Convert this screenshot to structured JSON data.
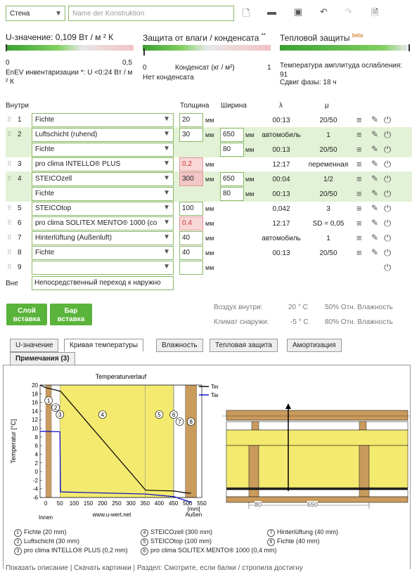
{
  "top": {
    "construction_type": "Стена",
    "name_placeholder": "Name der Konstruktion"
  },
  "ratings": {
    "u_title": "U-значение: 0,109 Вт / м ² К",
    "u_scale_min": "0",
    "u_scale_max": "0,5",
    "u_note": "EnEV инвентаризации *: U <0:24 Вт / м ² К",
    "moist_title": "Защита от влаги / конденсата",
    "moist_stars": "**",
    "moist_min": "0",
    "moist_label": "Конденсат (кг / м²)",
    "moist_max": "1",
    "moist_note": "Нет конденсата",
    "heat_title": "Тепловой защиты",
    "heat_beta": "beta",
    "heat_note1": "Температура амплитуда ослабления: 91",
    "heat_note2": "Сдвиг фазы: 18 ч"
  },
  "table": {
    "col_inside": "Внутри",
    "col_thickness": "Толщина",
    "col_width": "Ширина",
    "col_lambda": "λ",
    "col_mu": "μ",
    "rows": [
      {
        "num": "1",
        "mat": "Fichte",
        "thick": "20",
        "unit": "мм",
        "width": "",
        "lambda": "00:13",
        "mu": "20/50"
      },
      {
        "num": "2",
        "mat": "Luftschicht (ruhend)",
        "thick": "30",
        "unit": "мм",
        "width": "650",
        "wunit": "мм",
        "lambda": "автомобиль",
        "mu": "1"
      },
      {
        "num": "",
        "mat": "Fichte",
        "thick": "",
        "unit": "",
        "width": "80",
        "wunit": "мм",
        "lambda": "00:13",
        "mu": "20/50"
      },
      {
        "num": "3",
        "mat": "pro clima INTELLO® PLUS",
        "thick": "0.2",
        "unit": "мм",
        "width": "",
        "lambda": "12:17",
        "mu": "переменная"
      },
      {
        "num": "4",
        "mat": "STEICOzell",
        "thick": "300",
        "unit": "мм",
        "width": "650",
        "wunit": "мм",
        "lambda": "00:04",
        "mu": "1/2"
      },
      {
        "num": "",
        "mat": "Fichte",
        "thick": "",
        "unit": "",
        "width": "80",
        "wunit": "мм",
        "lambda": "00:13",
        "mu": "20/50"
      },
      {
        "num": "5",
        "mat": "STEICOtop",
        "thick": "100",
        "unit": "мм",
        "width": "",
        "lambda": "0,042",
        "mu": "3"
      },
      {
        "num": "6",
        "mat": "pro clima SOLITEX MENTO® 1000 (co",
        "thick": "0.4",
        "unit": "мм",
        "width": "",
        "lambda": "12:17",
        "mu": "SD = 0,05"
      },
      {
        "num": "7",
        "mat": "Hinterlüftung (Außenluft)",
        "thick": "40",
        "unit": "мм",
        "width": "",
        "lambda": "автомобиль",
        "mu": "1"
      },
      {
        "num": "8",
        "mat": "Fichte",
        "thick": "40",
        "unit": "мм",
        "width": "",
        "lambda": "00:13",
        "mu": "20/50"
      },
      {
        "num": "9",
        "mat": "",
        "thick": "",
        "unit": "мм",
        "width": "",
        "lambda": "",
        "mu": ""
      }
    ],
    "outside_label": "Вне",
    "outside_value": "Непосредственный переход к наружно"
  },
  "buttons": {
    "layer_insert": "Слой вставка",
    "bar_insert": "Бар вставка"
  },
  "climate": {
    "inside_label": "Воздух внутри:",
    "inside_temp": "20 ° C",
    "inside_hum": "50% Отн. Влажность",
    "outside_label": "Климат снаружи:",
    "outside_temp": "-5 ° C",
    "outside_hum": "80% Отн. Влажность"
  },
  "tabs": [
    "U-значение",
    "Кривая температуры",
    "Влажность",
    "Тепловая защита",
    "Амортизация",
    "Примечания (3)"
  ],
  "chart_data": {
    "type": "line",
    "title": "Temperaturverlauf",
    "ylabel": "Temperatur [°C]",
    "xlabel": "[mm]",
    "x_ticks": [
      "0",
      "50",
      "100",
      "150",
      "200",
      "250",
      "300",
      "350",
      "400",
      "450",
      "500",
      "550"
    ],
    "y_ticks": [
      "-6",
      "-4",
      "-2",
      "0",
      "2",
      "4",
      "6",
      "8",
      "10",
      "12",
      "14",
      "16",
      "18",
      "20"
    ],
    "ylim": [
      -6,
      20
    ],
    "xlim": [
      0,
      550
    ],
    "left_label": "Innen",
    "right_label": "Außen",
    "watermark": "www.u-wert.net",
    "series": [
      {
        "name": "Temperatur",
        "color": "#000000",
        "x": [
          -20,
          0,
          20,
          50,
          52,
          352,
          452,
          492,
          512
        ],
        "y": [
          20,
          19.4,
          19.1,
          18.6,
          18.6,
          -4.3,
          -4.5,
          -4.9,
          -5
        ]
      },
      {
        "name": "Taupunkt",
        "color": "#0000cc",
        "x": [
          -20,
          0,
          50,
          52,
          352,
          452,
          512
        ],
        "y": [
          9.3,
          9.3,
          9.2,
          -4.7,
          -5.2,
          -5.8,
          -7.1
        ]
      }
    ],
    "layer_marks": [
      "1",
      "2",
      "3",
      "4",
      "5",
      "6",
      "7",
      "8"
    ],
    "section_dim_left": "80",
    "section_dim_right": "650"
  },
  "legend_items": [
    "Fichte (20 mm)",
    "Luftschicht (30 mm)",
    "pro clima INTELLO® PLUS (0,2 mm)",
    "STEICOzell (300 mm)",
    "STEICOtop (100 mm)",
    "pro clima SOLITEX MENTO® 1000 (0,4 mm)",
    "Hinterlüftung (40 mm)",
    "Fichte (40 mm)"
  ],
  "footer": "Показать описание | Скачать картинки | Раздел: Смотрите, если балки / стропила достигну"
}
